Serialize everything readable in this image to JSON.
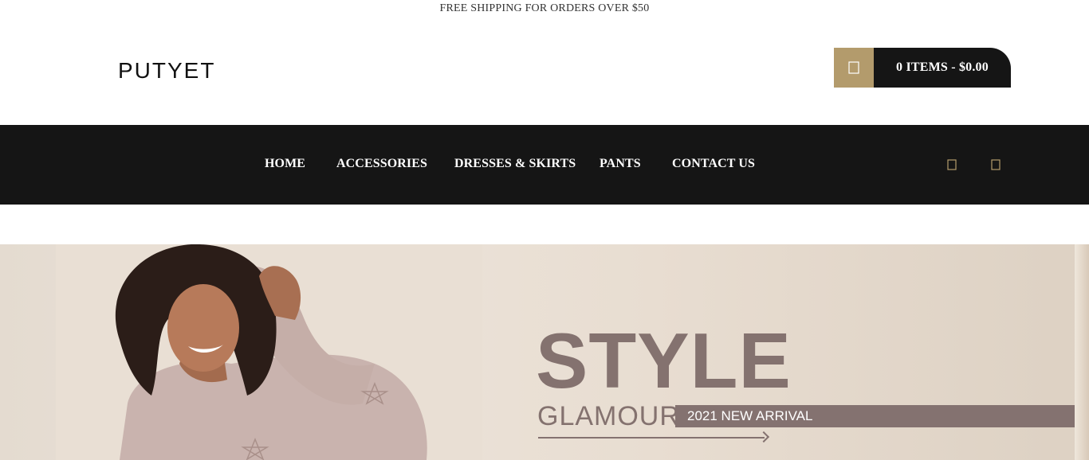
{
  "topbar": {
    "text": "FREE SHIPPING FOR ORDERS OVER $50"
  },
  "header": {
    "logo": "PUTYET",
    "cart": {
      "label": "0 ITEMS - $0.00",
      "icon": "cart-icon"
    }
  },
  "nav": {
    "items": [
      {
        "label": "HOME"
      },
      {
        "label": "ACCESSORIES"
      },
      {
        "label": "DRESSES & SKIRTS"
      },
      {
        "label": "PANTS"
      },
      {
        "label": "CONTACT US"
      }
    ],
    "icons": [
      "search-icon",
      "user-icon"
    ]
  },
  "hero": {
    "title": "STYLE",
    "subtitle": "GLAMOUR",
    "band": "2021 NEW ARRIVAL"
  },
  "colors": {
    "accent": "#b39b6c",
    "dark": "#151515",
    "hero_text": "#84726f"
  }
}
